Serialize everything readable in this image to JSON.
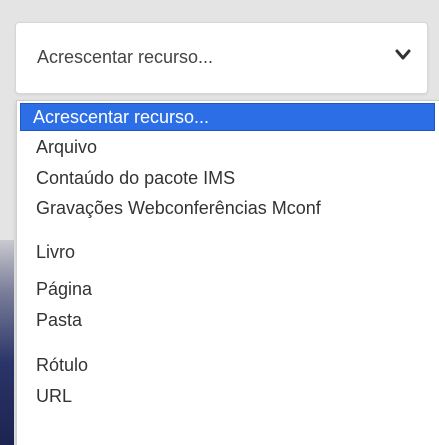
{
  "select": {
    "value": "Acrescentar recurso...",
    "chevron_icon": "chevron-down-icon"
  },
  "dropdown": {
    "options": [
      {
        "label": "Acrescentar recurso...",
        "selected": true
      },
      {
        "label": "Arquivo",
        "selected": false
      },
      {
        "label": "Contaúdo do pacote IMS",
        "selected": false
      },
      {
        "label": "Gravações Webconferências Mconf",
        "selected": false
      },
      {
        "label": "Livro",
        "selected": false
      },
      {
        "label": "Página",
        "selected": false
      },
      {
        "label": "Pasta",
        "selected": false
      },
      {
        "label": "Rótulo",
        "selected": false
      },
      {
        "label": "URL",
        "selected": false
      }
    ]
  },
  "colors": {
    "selection": "#2b6ee6",
    "text": "#333333",
    "background": "#e4e4e4"
  }
}
